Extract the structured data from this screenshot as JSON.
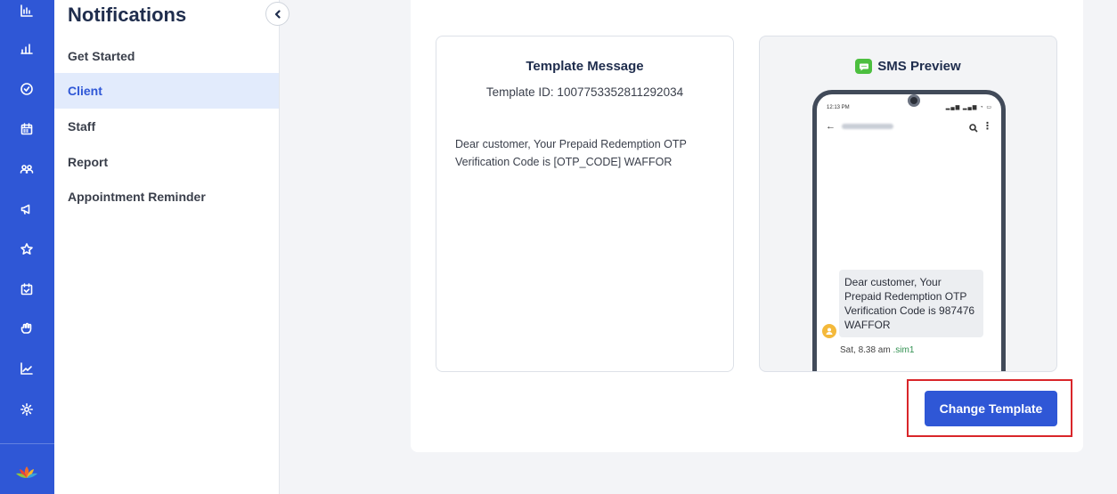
{
  "rail": {
    "icons": [
      "dashboard-chart-icon",
      "bar-chart-icon",
      "check-circle-icon",
      "calendar-icon",
      "clients-icon",
      "megaphone-icon",
      "star-icon",
      "calendar-check-icon",
      "hand-icon",
      "trend-chart-icon",
      "settings-gear-icon"
    ],
    "logo": "lotus-logo"
  },
  "sidebar": {
    "title": "Notifications",
    "items": [
      {
        "label": "Get Started",
        "active": false
      },
      {
        "label": "Client",
        "active": true
      },
      {
        "label": "Staff",
        "active": false
      },
      {
        "label": "Report",
        "active": false
      },
      {
        "label": "Appointment Reminder",
        "active": false
      }
    ]
  },
  "template": {
    "title": "Template Message",
    "id_text": "Template ID: 1007753352811292034",
    "body": "Dear customer, Your Prepaid Redemption OTP Verification Code is [OTP_CODE] WAFFOR"
  },
  "preview": {
    "title": "SMS Preview",
    "status_time": "12:13 PM",
    "message": "Dear customer, Your Prepaid Redemption OTP Verification Code is 987476 WAFFOR",
    "meta_time": "Sat, 8.38 am",
    "meta_sim": "sim1"
  },
  "actions": {
    "change_template": "Change Template"
  },
  "colors": {
    "primary": "#2f57d6",
    "active_bg": "#e2ebfc",
    "sms_green": "#4cbf3f",
    "highlight": "#d9262a"
  }
}
